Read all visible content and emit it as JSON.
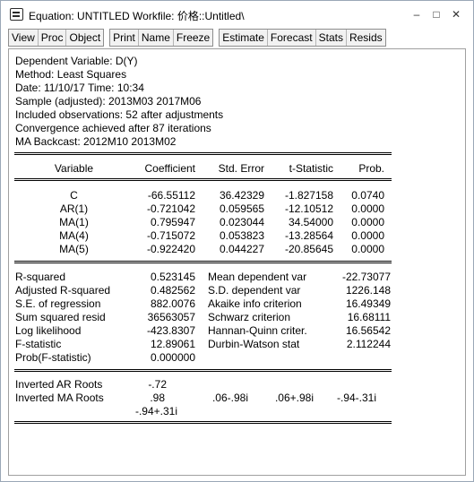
{
  "window": {
    "title": "Equation: UNTITLED   Workfile: 价格::Untitled\\",
    "controls": {
      "minimize": "–",
      "restore": "□",
      "close": "✕"
    }
  },
  "toolbar": {
    "group1": [
      "View",
      "Proc",
      "Object"
    ],
    "group2": [
      "Print",
      "Name",
      "Freeze"
    ],
    "group3": [
      "Estimate",
      "Forecast",
      "Stats",
      "Resids"
    ]
  },
  "header": {
    "lines": [
      "Dependent Variable: D(Y)",
      "Method: Least Squares",
      "Date: 11/10/17   Time: 10:34",
      "Sample (adjusted): 2013M03 2017M06",
      "Included observations: 52 after adjustments",
      "Convergence achieved after 87 iterations",
      "MA Backcast: 2012M10 2013M02"
    ]
  },
  "coef_table": {
    "columns": [
      "Variable",
      "Coefficient",
      "Std. Error",
      "t-Statistic",
      "Prob."
    ],
    "rows": [
      [
        "C",
        "-66.55112",
        "36.42329",
        "-1.827158",
        "0.0740"
      ],
      [
        "AR(1)",
        "-0.721042",
        "0.059565",
        "-12.10512",
        "0.0000"
      ],
      [
        "MA(1)",
        "0.795947",
        "0.023044",
        "34.54000",
        "0.0000"
      ],
      [
        "MA(4)",
        "-0.715072",
        "0.053823",
        "-13.28564",
        "0.0000"
      ],
      [
        "MA(5)",
        "-0.922420",
        "0.044227",
        "-20.85645",
        "0.0000"
      ]
    ]
  },
  "stats": {
    "left": [
      [
        "R-squared",
        "0.523145"
      ],
      [
        "Adjusted R-squared",
        "0.482562"
      ],
      [
        "S.E. of regression",
        "882.0076"
      ],
      [
        "Sum squared resid",
        "36563057"
      ],
      [
        "Log likelihood",
        "-423.8307"
      ],
      [
        "F-statistic",
        "12.89061"
      ],
      [
        "Prob(F-statistic)",
        "0.000000"
      ]
    ],
    "right": [
      [
        "Mean dependent var",
        "-22.73077"
      ],
      [
        "S.D. dependent var",
        "1226.148"
      ],
      [
        "Akaike info criterion",
        "16.49349"
      ],
      [
        "Schwarz criterion",
        "16.68111"
      ],
      [
        "Hannan-Quinn criter.",
        "16.56542"
      ],
      [
        "Durbin-Watson stat",
        "2.112244"
      ]
    ]
  },
  "roots": {
    "ar_label": "Inverted AR Roots",
    "ar_values": [
      "-.72"
    ],
    "ma_label": "Inverted MA Roots",
    "ma_values": [
      ".98",
      ".06-.98i",
      ".06+.98i",
      "-.94-.31i"
    ],
    "ma_values_row2": [
      "-.94+.31i"
    ]
  }
}
